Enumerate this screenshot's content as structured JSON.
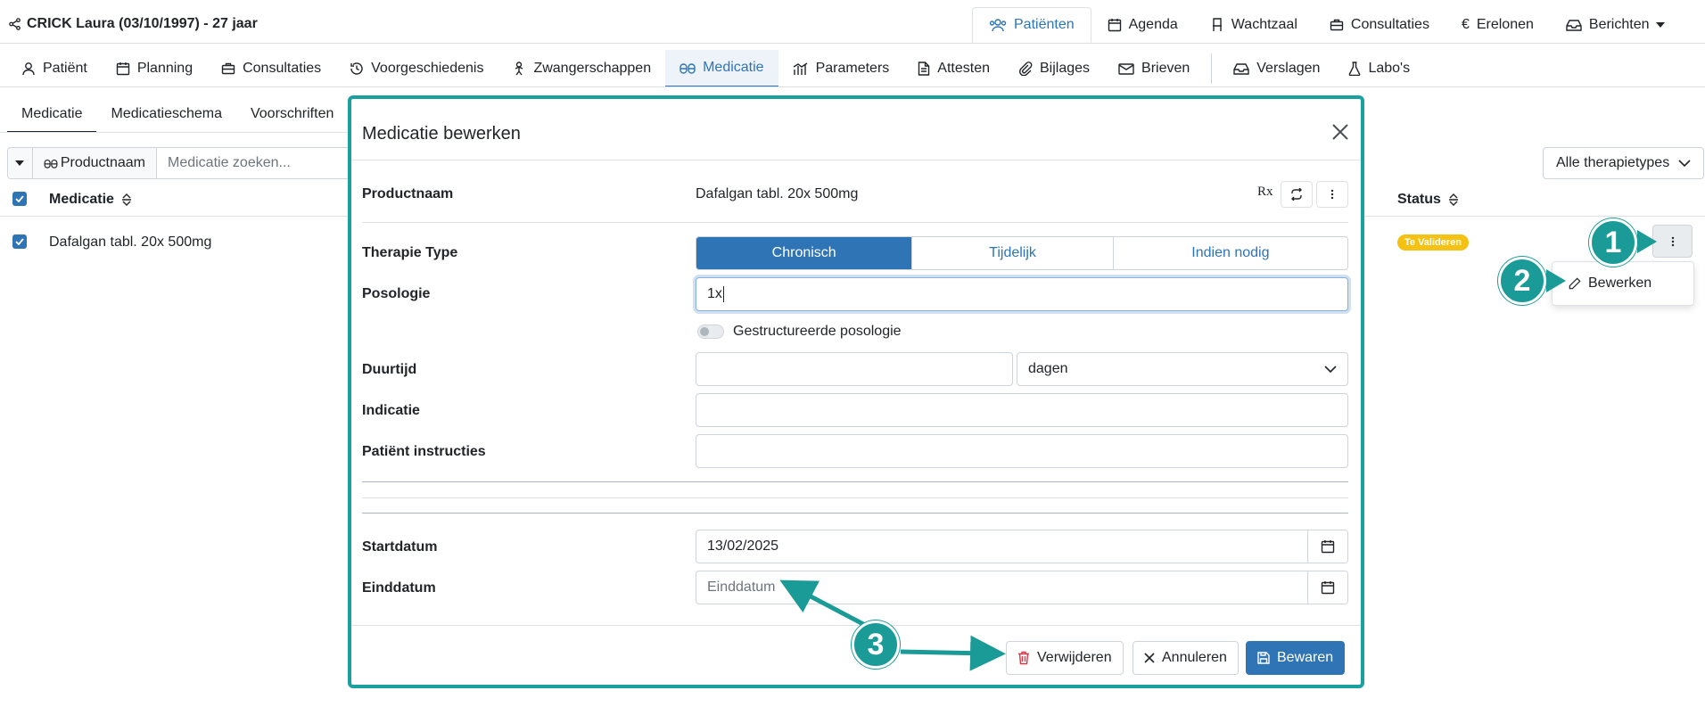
{
  "header": {
    "patient_title": "CRICK Laura (03/10/1997) - 27 jaar"
  },
  "top_nav": [
    {
      "label": "Patiënten",
      "icon": "users-icon"
    },
    {
      "label": "Agenda",
      "icon": "calendar-icon"
    },
    {
      "label": "Wachtzaal",
      "icon": "chair-icon"
    },
    {
      "label": "Consultaties",
      "icon": "briefcase-icon"
    },
    {
      "label": "Erelonen",
      "icon": "euro-icon"
    },
    {
      "label": "Berichten",
      "icon": "inbox-icon"
    }
  ],
  "secondary_nav": [
    {
      "label": "Patiënt",
      "icon": "person-icon"
    },
    {
      "label": "Planning",
      "icon": "calendar-icon"
    },
    {
      "label": "Consultaties",
      "icon": "briefcase-icon"
    },
    {
      "label": "Voorgeschiedenis",
      "icon": "history-icon"
    },
    {
      "label": "Zwangerschappen",
      "icon": "baby-icon"
    },
    {
      "label": "Medicatie",
      "icon": "pills-icon"
    },
    {
      "label": "Parameters",
      "icon": "chart-icon"
    },
    {
      "label": "Attesten",
      "icon": "file-icon"
    },
    {
      "label": "Bijlages",
      "icon": "paperclip-icon"
    },
    {
      "label": "Brieven",
      "icon": "envelope-icon"
    },
    {
      "label": "Verslagen",
      "icon": "inbox-icon"
    },
    {
      "label": "Labo's",
      "icon": "flask-icon"
    }
  ],
  "sub_tabs": [
    "Medicatie",
    "Medicatieschema",
    "Voorschriften"
  ],
  "search": {
    "product_button": "Productnaam",
    "placeholder": "Medicatie zoeken..."
  },
  "list": {
    "col_medicatie": "Medicatie",
    "col_status": "Status",
    "row_name": "Dafalgan tabl. 20x 500mg",
    "row_status": "Te Valideren"
  },
  "therapy_filter": "Alle therapietypes",
  "row_menu": {
    "edit_label": "Bewerken"
  },
  "markers": [
    "1",
    "2",
    "3"
  ],
  "modal": {
    "title": "Medicatie bewerken",
    "productnaam_label": "Productnaam",
    "productnaam_value": "Dafalgan tabl. 20x 500mg",
    "rx_icon": "Rx",
    "therapie_label": "Therapie Type",
    "therapie_options": [
      "Chronisch",
      "Tijdelijk",
      "Indien nodig"
    ],
    "posologie_label": "Posologie",
    "posologie_value": "1x",
    "structured_label": "Gestructureerde posologie",
    "duurtijd_label": "Duurtijd",
    "duurtijd_value": "",
    "duurtijd_unit": "dagen",
    "indicatie_label": "Indicatie",
    "indicatie_value": "",
    "instructies_label": "Patiënt instructies",
    "instructies_value": "",
    "startdatum_label": "Startdatum",
    "startdatum_value": "13/02/2025",
    "einddatum_label": "Einddatum",
    "einddatum_placeholder": "Einddatum",
    "delete_label": "Verwijderen",
    "cancel_label": "Annuleren",
    "save_label": "Bewaren"
  },
  "colors": {
    "primary": "#2f74b5",
    "annotation": "#1aa19f",
    "badge": "#f5c112",
    "danger": "#dc3545"
  }
}
